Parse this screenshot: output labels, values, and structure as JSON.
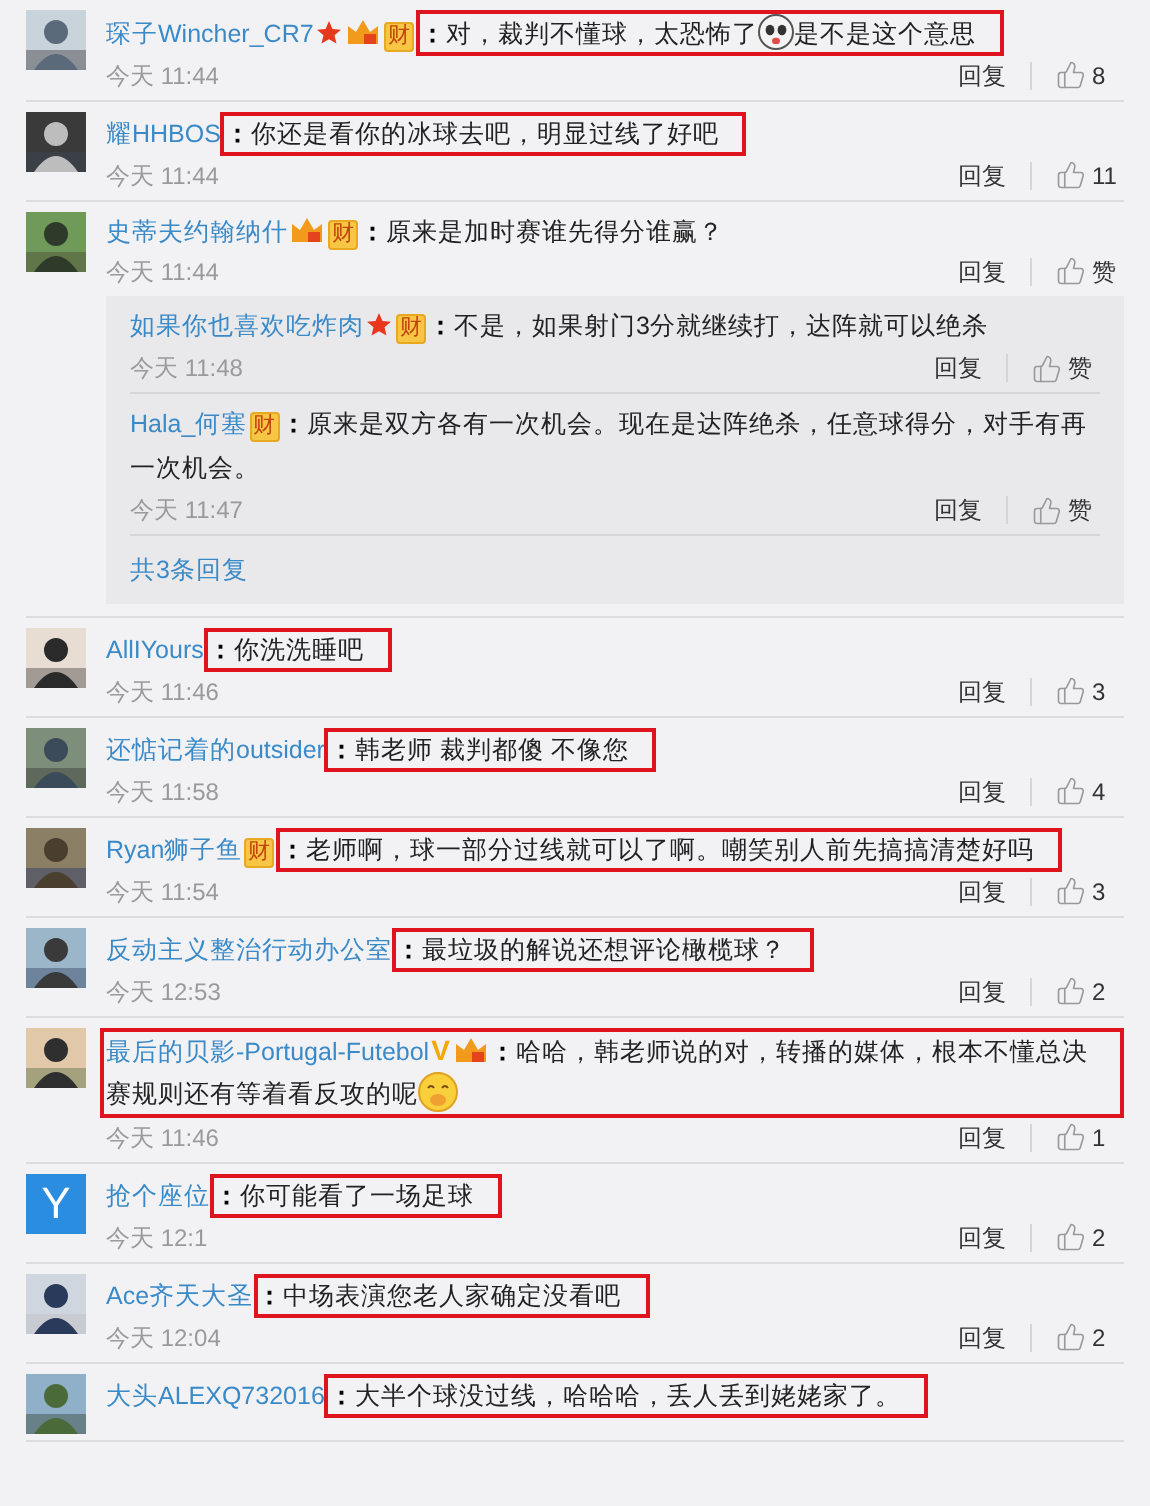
{
  "comments": [
    {
      "avatar": {
        "kind": "picture"
      },
      "name": "琛子Wincher_CR7",
      "badges": [
        {
          "kind": "star"
        },
        {
          "kind": "vip"
        },
        {
          "kind": "tag",
          "text": "财"
        }
      ],
      "sep": "：",
      "parts": [
        {
          "kind": "text",
          "text": "对，裁判不懂球，太恐怖了"
        },
        {
          "kind": "panda_emoji"
        },
        {
          "kind": "text",
          "text": "是不是这个意思"
        }
      ],
      "highlighted": true,
      "time": "今天 11:44",
      "reply": "回复",
      "like": "8"
    },
    {
      "avatar": {
        "kind": "picture"
      },
      "name": "耀HHBOS",
      "sep": "：",
      "parts": [
        {
          "kind": "text",
          "text": "你还是看你的冰球去吧，明显过线了好吧"
        }
      ],
      "highlighted": true,
      "time": "今天 11:44",
      "reply": "回复",
      "like": "11"
    },
    {
      "avatar": {
        "kind": "picture"
      },
      "name": "史蒂夫约翰纳什",
      "badges": [
        {
          "kind": "vip"
        },
        {
          "kind": "tag",
          "text": "财"
        }
      ],
      "sep": "：",
      "parts": [
        {
          "kind": "text",
          "text": "原来是加时赛谁先得分谁赢？"
        }
      ],
      "highlighted": false,
      "time": "今天 11:44",
      "reply": "回复",
      "like": "赞",
      "replies": {
        "items": [
          {
            "name": "如果你也喜欢吃炸肉",
            "badges": [
              {
                "kind": "star"
              },
              {
                "kind": "tag",
                "text": "财"
              }
            ],
            "sep": "：",
            "text": "不是，如果射门3分就继续打，达阵就可以绝杀",
            "time": "今天 11:48",
            "reply": "回复",
            "like": "赞"
          },
          {
            "name": "Hala_何塞",
            "badges": [
              {
                "kind": "tag",
                "text": "财"
              }
            ],
            "sep": "：",
            "text": "原来是双方各有一次机会。现在是达阵绝杀，任意球得分，对手有再一次机会。",
            "time": "今天 11:47",
            "reply": "回复",
            "like": "赞"
          }
        ],
        "more": "共3条回复"
      }
    },
    {
      "avatar": {
        "kind": "picture"
      },
      "name": "AllIYours",
      "sep": "：",
      "parts": [
        {
          "kind": "text",
          "text": "你洗洗睡吧"
        }
      ],
      "highlighted": true,
      "time": "今天 11:46",
      "reply": "回复",
      "like": "3"
    },
    {
      "avatar": {
        "kind": "picture"
      },
      "name": "还惦记着的outsider",
      "sep": "：",
      "parts": [
        {
          "kind": "text",
          "text": "韩老师  裁判都傻  不像您"
        }
      ],
      "highlighted": true,
      "time": "今天 11:58",
      "reply": "回复",
      "like": "4"
    },
    {
      "avatar": {
        "kind": "picture"
      },
      "name": "Ryan狮子鱼",
      "badges": [
        {
          "kind": "tag",
          "text": "财"
        }
      ],
      "sep": "：",
      "parts": [
        {
          "kind": "text",
          "text": "老师啊，球一部分过线就可以了啊。嘲笑别人前先搞搞清楚好吗"
        }
      ],
      "highlighted": true,
      "time": "今天 11:54",
      "reply": "回复",
      "like": "3"
    },
    {
      "avatar": {
        "kind": "picture"
      },
      "name": "反动主义整治行动办公室",
      "sep": "：",
      "parts": [
        {
          "kind": "text",
          "text": "最垃圾的解说还想评论橄榄球？"
        }
      ],
      "highlighted": true,
      "time": "今天 12:53",
      "reply": "回复",
      "like": "2"
    },
    {
      "avatar": {
        "kind": "picture"
      },
      "name": "最后的贝影-Portugal-Futebol",
      "badges": [
        {
          "kind": "verified",
          "text": "V"
        },
        {
          "kind": "vip"
        }
      ],
      "sep": "：",
      "parts": [
        {
          "kind": "text",
          "text": "哈哈，韩老师说的对，转播的媒体，根本不懂总决赛规则还有等着看反攻的呢"
        },
        {
          "kind": "smiley_emoji"
        }
      ],
      "highlighted": true,
      "highlight_includes_name": true,
      "time": "今天 11:46",
      "reply": "回复",
      "like": "1"
    },
    {
      "avatar": {
        "kind": "letter",
        "letter": "Y"
      },
      "name": "抢个座位",
      "sep": "：",
      "parts": [
        {
          "kind": "text",
          "text": "你可能看了一场足球"
        }
      ],
      "highlighted": true,
      "time": "今天 12:1",
      "reply": "回复",
      "like": "2"
    },
    {
      "avatar": {
        "kind": "picture"
      },
      "name": "Ace齐天大圣",
      "sep": "：",
      "parts": [
        {
          "kind": "text",
          "text": "中场表演您老人家确定没看吧"
        }
      ],
      "highlighted": true,
      "time": "今天 12:04",
      "reply": "回复",
      "like": "2"
    },
    {
      "avatar": {
        "kind": "picture"
      },
      "name": "大头ALEXQ732016",
      "sep": "：",
      "parts": [
        {
          "kind": "text",
          "text": "大半个球没过线，哈哈哈，丢人丢到姥姥家了。"
        }
      ],
      "highlighted": true
    }
  ]
}
